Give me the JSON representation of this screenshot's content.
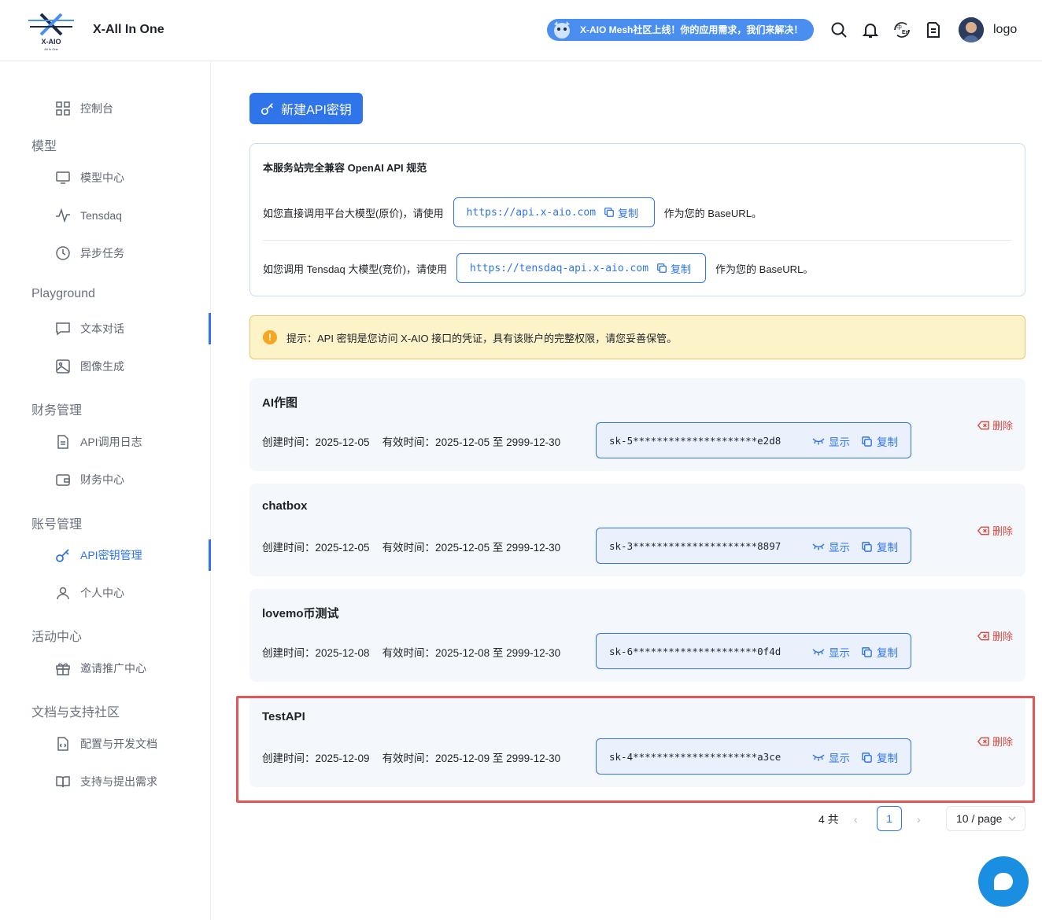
{
  "header": {
    "logo_text": "X-AIO",
    "logo_subtext": "All In One",
    "app_title": "X-All In One",
    "banner_text": "X-AIO Mesh社区上线！你的应用需求，我们来解决！",
    "user_name": "logo"
  },
  "sidebar": {
    "items": [
      {
        "label": "控制台"
      },
      {
        "group": "模型"
      },
      {
        "label": "模型中心"
      },
      {
        "label": "Tensdaq"
      },
      {
        "label": "异步任务"
      },
      {
        "group": "Playground"
      },
      {
        "label": "文本对话"
      },
      {
        "label": "图像生成"
      },
      {
        "group": "财务管理"
      },
      {
        "label": "API调用日志"
      },
      {
        "label": "财务中心"
      },
      {
        "group": "账号管理"
      },
      {
        "label": "API密钥管理"
      },
      {
        "label": "个人中心"
      },
      {
        "group": "活动中心"
      },
      {
        "label": "邀请推广中心"
      },
      {
        "group": "文档与支持社区"
      },
      {
        "label": "配置与开发文档"
      },
      {
        "label": "支持与提出需求"
      }
    ]
  },
  "main": {
    "new_button_label": "新建API密钥",
    "info": {
      "title": "本服务站完全兼容 OpenAI API 规范",
      "row1_prefix": "如您直接调用平台大模型(原价)，请使用",
      "row1_url": "https://api.x-aio.com",
      "row1_suffix": "作为您的 BaseURL。",
      "row2_prefix": "如您调用 Tensdaq 大模型(竞价)，请使用",
      "row2_url": "https://tensdaq-api.x-aio.com",
      "row2_suffix": "作为您的 BaseURL。",
      "copy_label": "复制"
    },
    "tip_text": "提示：API 密钥是您访问 X-AIO 接口的凭证，具有该账户的完整权限，请您妥善保管。",
    "keys": [
      {
        "name": "AI作图",
        "created": "创建时间：2025-12-05",
        "valid": "有效时间：2025-12-05 至 2999-12-30",
        "masked": "sk-5*********************e2d8"
      },
      {
        "name": "chatbox",
        "created": "创建时间：2025-12-05",
        "valid": "有效时间：2025-12-05 至 2999-12-30",
        "masked": "sk-3*********************8897"
      },
      {
        "name": "lovemo币测试",
        "created": "创建时间：2025-12-08",
        "valid": "有效时间：2025-12-08 至 2999-12-30",
        "masked": "sk-6*********************0f4d"
      },
      {
        "name": "TestAPI",
        "created": "创建时间：2025-12-09",
        "valid": "有效时间：2025-12-09 至 2999-12-30",
        "masked": "sk-4*********************a3ce"
      }
    ],
    "show_label": "显示",
    "copy_label": "复制",
    "delete_label": "删除"
  },
  "pagination": {
    "total": "4 共",
    "current_page": "1",
    "page_size": "10 / page"
  },
  "colors": {
    "primary": "#2f74e8",
    "danger": "#e0483f",
    "highlight": "#e15759",
    "tip_bg": "#fdf3c9"
  }
}
